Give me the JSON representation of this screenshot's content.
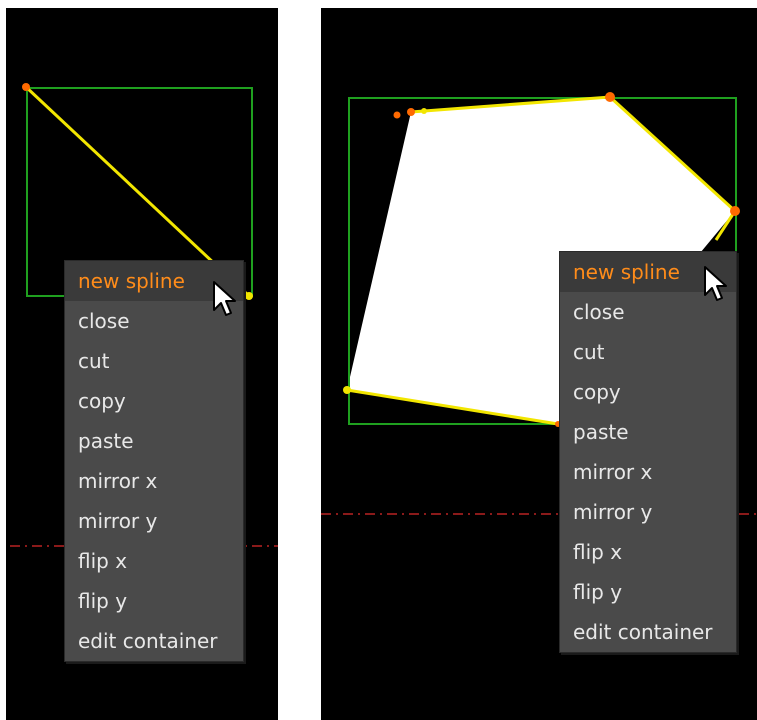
{
  "menu_items": [
    {
      "label": "new spline"
    },
    {
      "label": "close"
    },
    {
      "label": "cut"
    },
    {
      "label": "copy"
    },
    {
      "label": "paste"
    },
    {
      "label": "mirror x"
    },
    {
      "label": "mirror y"
    },
    {
      "label": "flip x"
    },
    {
      "label": "flip y"
    },
    {
      "label": "edit container"
    }
  ],
  "colors": {
    "background": "#000000",
    "bounding_box": "#1fa01f",
    "spline": "#f2e600",
    "control_point": "#ff6a00",
    "highlight_text": "#ff8c1a",
    "guide_line": "#8b1a1a",
    "fill": "#ffffff"
  },
  "icons": [
    "mouse-cursor-icon"
  ]
}
